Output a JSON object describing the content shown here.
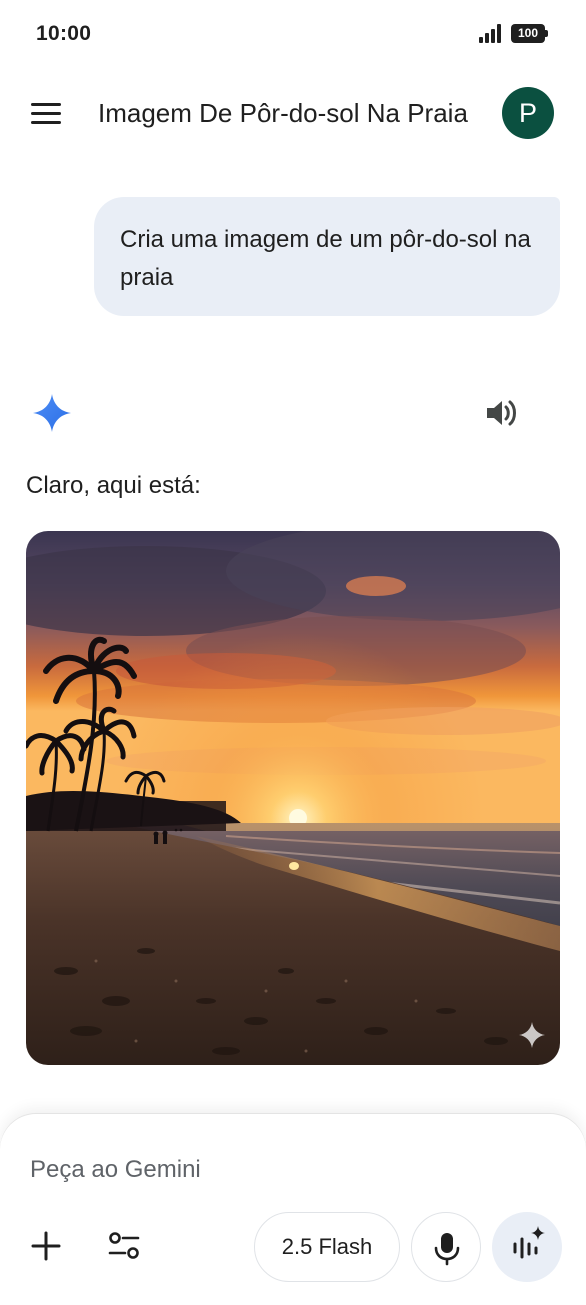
{
  "status_bar": {
    "time": "10:00",
    "battery": "100"
  },
  "header": {
    "title": "Imagem De Pôr-do-sol Na Praia",
    "avatar_initial": "P"
  },
  "conversation": {
    "user_message": "Cria uma imagem de um pôr-do-sol na praia",
    "response_text": "Claro, aqui está:",
    "image_alt": "Pôr-do-sol na praia"
  },
  "composer": {
    "placeholder": "Peça ao Gemini",
    "model_label": "2.5 Flash"
  },
  "icons": {
    "menu": "menu-icon",
    "gemini": "gemini-sparkle-icon",
    "speaker": "speaker-icon",
    "plus": "plus-icon",
    "tools": "tools-icon",
    "mic": "microphone-icon",
    "live": "live-sparkle-icon"
  },
  "colors": {
    "avatar": "#0b5040",
    "bubble": "#e9eef6",
    "gemini_blue": "#4285f4"
  }
}
